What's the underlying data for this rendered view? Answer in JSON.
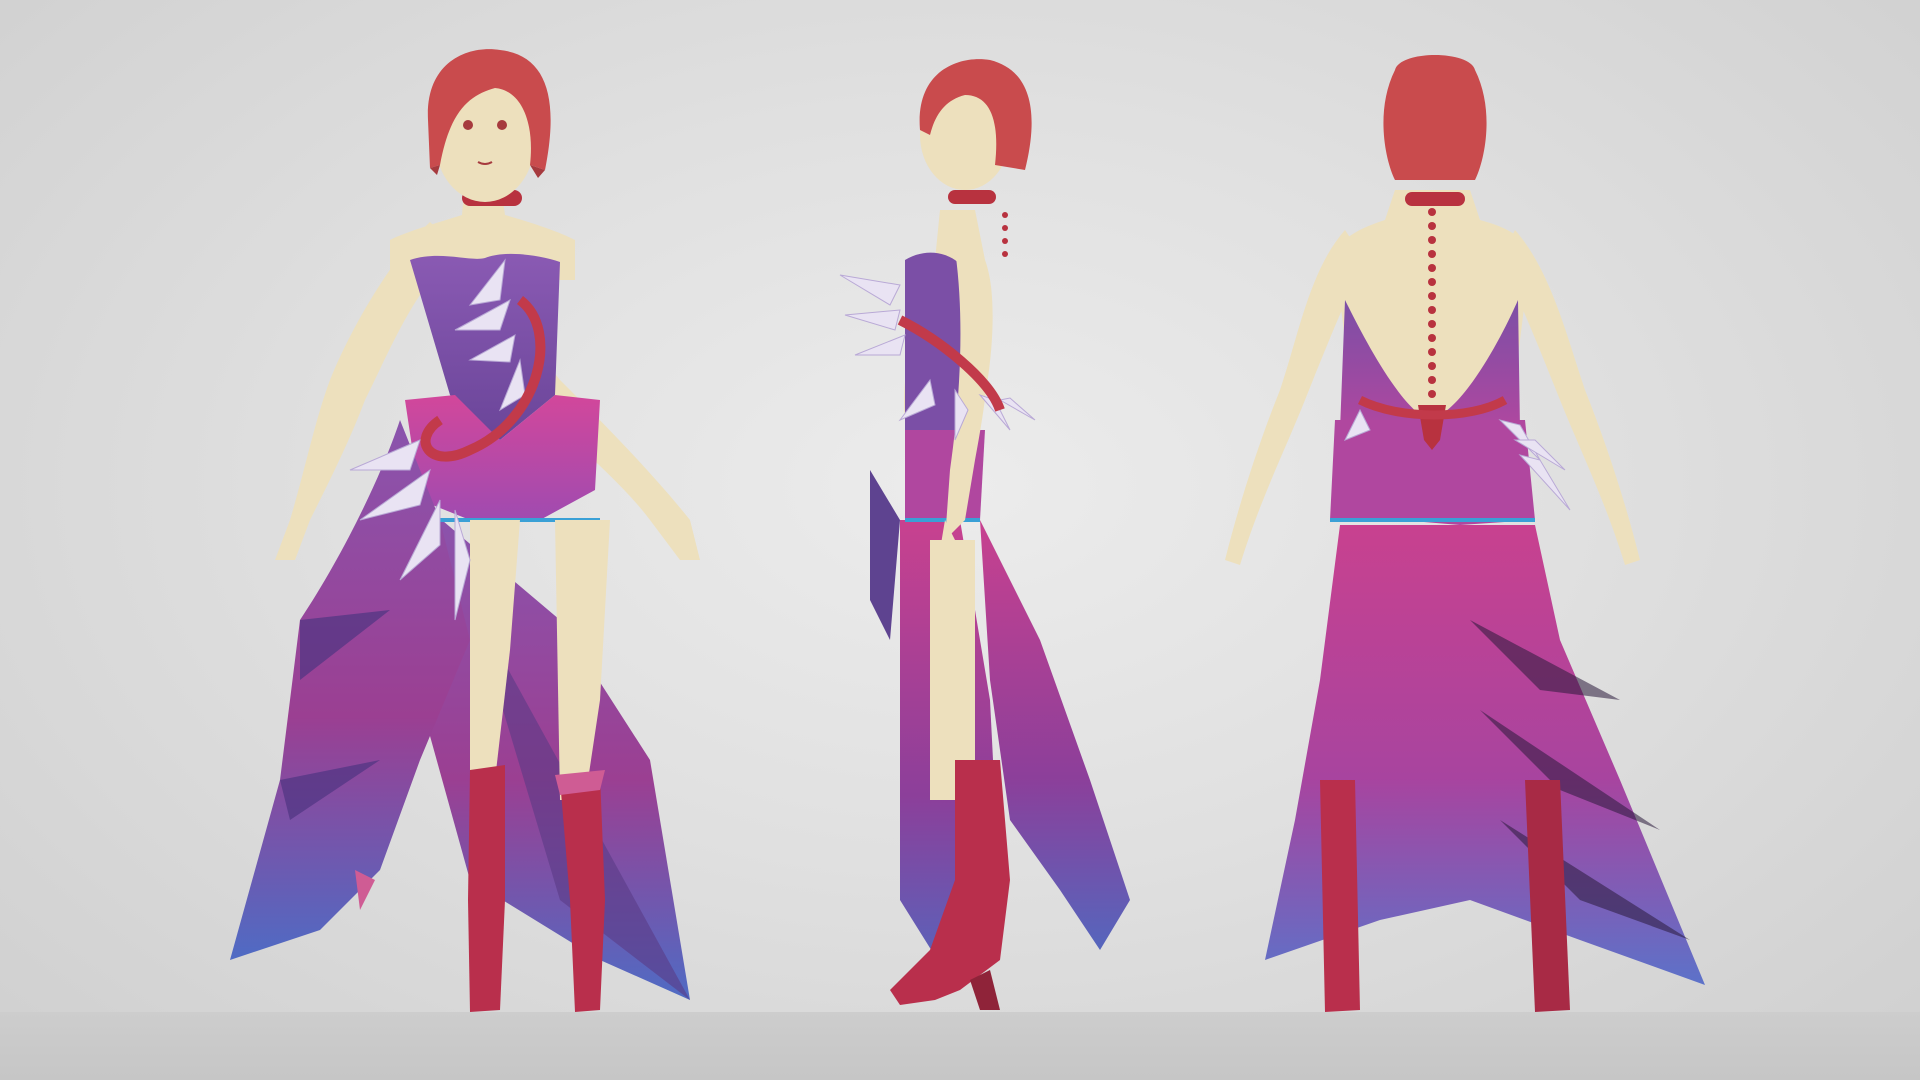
{
  "scene": {
    "background_color": "#e3e3e3",
    "floor_color": "#c8c8c8"
  },
  "character": {
    "views": [
      "front",
      "side",
      "back"
    ],
    "palette": {
      "skin": "#ede0bd",
      "hair": "#c94b4d",
      "dress_violet": "#7b4fa6",
      "dress_magenta": "#c8418f",
      "dress_blue": "#5b6ec7",
      "boots": "#b92f4c",
      "feathers": "#e9e3f3",
      "sash": "#c23a4a"
    }
  }
}
